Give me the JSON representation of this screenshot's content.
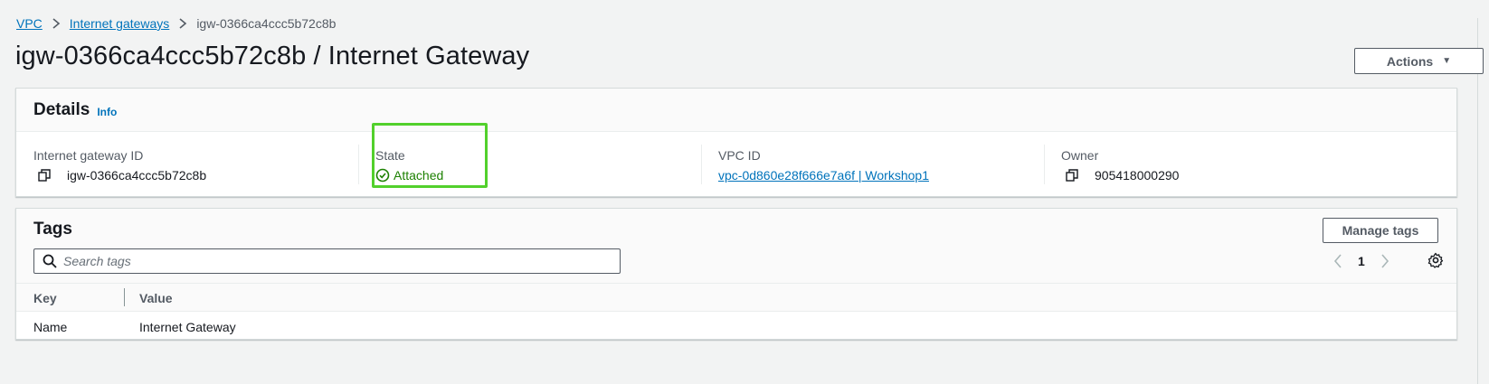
{
  "breadcrumb": {
    "items": [
      "VPC",
      "Internet gateways"
    ],
    "current": "igw-0366ca4ccc5b72c8b"
  },
  "header": {
    "title": "igw-0366ca4ccc5b72c8b / Internet Gateway",
    "actions_label": "Actions"
  },
  "details": {
    "title": "Details",
    "info_label": "Info",
    "fields": {
      "igw_id": {
        "label": "Internet gateway ID",
        "value": "igw-0366ca4ccc5b72c8b"
      },
      "state": {
        "label": "State",
        "value": "Attached"
      },
      "vpc_id": {
        "label": "VPC ID",
        "value": "vpc-0d860e28f666e7a6f | Workshop1"
      },
      "owner": {
        "label": "Owner",
        "value": "905418000290"
      }
    }
  },
  "tags": {
    "title": "Tags",
    "manage_label": "Manage tags",
    "search_placeholder": "Search tags",
    "page": "1",
    "columns": [
      "Key",
      "Value"
    ],
    "rows": [
      {
        "key": "Name",
        "value": "Internet Gateway"
      }
    ]
  },
  "colors": {
    "link": "#0073bb",
    "success": "#1d8102",
    "highlight": "#52d02c"
  }
}
